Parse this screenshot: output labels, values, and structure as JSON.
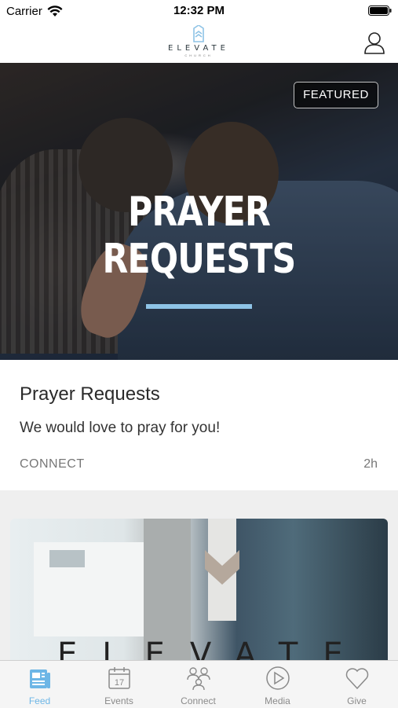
{
  "status_bar": {
    "carrier": "Carrier",
    "time": "12:32 PM"
  },
  "header": {
    "logo_text": "ELEVATE",
    "logo_subtext": "CHURCH"
  },
  "featured_post": {
    "badge": "FEATURED",
    "hero_title": "PRAYER REQUESTS",
    "title": "Prayer Requests",
    "description": "We would love to pray for you!",
    "category": "CONNECT",
    "age": "2h"
  },
  "second_post": {
    "image_text": "ELEVATE"
  },
  "tabs": [
    {
      "label": "Feed",
      "icon": "feed-icon",
      "active": true
    },
    {
      "label": "Events",
      "icon": "calendar-icon",
      "active": false
    },
    {
      "label": "Connect",
      "icon": "people-icon",
      "active": false
    },
    {
      "label": "Media",
      "icon": "play-icon",
      "active": false
    },
    {
      "label": "Give",
      "icon": "heart-icon",
      "active": false
    }
  ],
  "calendar_icon_day": "17",
  "colors": {
    "accent": "#6db6e6",
    "underline": "#8ec3e6",
    "inactive": "#8a8a8a"
  }
}
